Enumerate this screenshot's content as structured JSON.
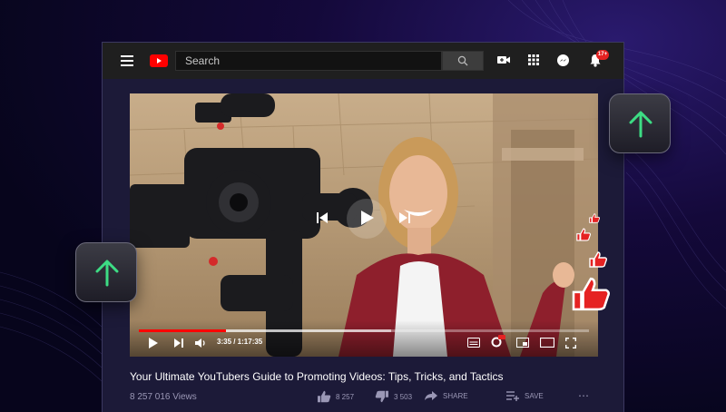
{
  "header": {
    "search_placeholder": "Search",
    "notification_count": "17+"
  },
  "player": {
    "time": "3:35 / 1:17:35",
    "progress": 0.193,
    "buffered": 0.56
  },
  "video": {
    "title": "Your Ultimate YouTubers Guide to Promoting Videos: Tips, Tricks, and Tactics",
    "views": "8 257 016 Views"
  },
  "actions": {
    "likes": "8 257",
    "dislikes": "3 503",
    "share_label": "SHARE",
    "save_label": "SAVE",
    "more_label": "⋯"
  },
  "colors": {
    "accent_red": "#ff0000",
    "arrow_green": "#3ddc84",
    "background": "#0d0a2c"
  }
}
